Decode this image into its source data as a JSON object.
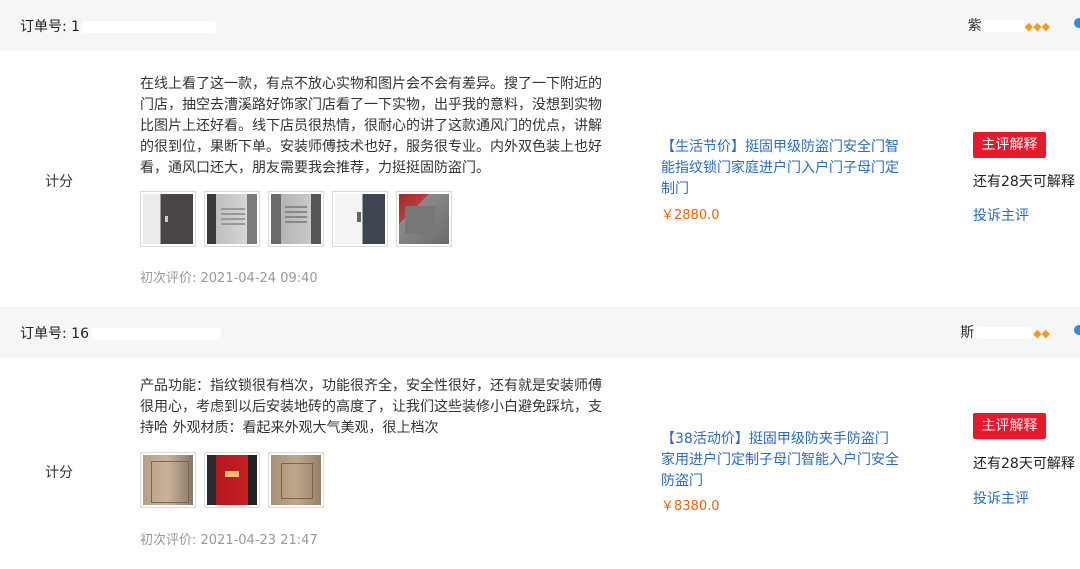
{
  "orders": [
    {
      "order_no_label": "订单号: 1",
      "buyer_name": "紫",
      "score_label": "计分",
      "review_text": "在线上看了这一款，有点不放心实物和图片会不会有差异。搜了一下附近的门店，抽空去漕溪路好饰家门店看了一下实物，出乎我的意料，没想到实物比图片上还好看。线下店员很热情，很耐心的讲了这款通风门的优点，讲解的很到位，果断下单。安装师傅技术也好，服务很专业。内外双色装上也好看，通风口还大，朋友需要我会推荐，力挺挺固防盗门。",
      "review_date": "初次评价: 2021-04-24 09:40",
      "product_title": "【生活节价】挺固甲级防盗门安全门智能指纹锁门家庭进户门入户门子母门定制门",
      "product_price": "￥2880.0",
      "reply_button": "主评解释",
      "remaining_text": "还有28天可解释",
      "complain_link": "投诉主评",
      "photos": [
        "door-photo-1",
        "door-photo-2",
        "door-photo-3",
        "door-photo-4",
        "door-photo-5"
      ]
    },
    {
      "order_no_label": "订单号: 16",
      "buyer_name": "斯",
      "score_label": "计分",
      "review_text": "产品功能：指纹锁很有档次，功能很齐全，安全性很好，还有就是安装师傅很用心，考虑到以后安装地砖的高度了，让我们这些装修小白避免踩坑，支持哈 外观材质：看起来外观大气美观，很上档次",
      "review_date": "初次评价: 2021-04-23 21:47",
      "product_title": "【38活动价】挺固甲级防夹手防盗门家用进户门定制子母门智能入户门安全防盗门",
      "product_price": "￥8380.0",
      "reply_button": "主评解释",
      "remaining_text": "还有28天可解释",
      "complain_link": "投诉主评",
      "photos": [
        "door-photo-1",
        "door-photo-2",
        "door-photo-3"
      ]
    }
  ],
  "colors": {
    "header_bg": "#f5f6f8",
    "link_blue": "#2a6bc4",
    "price_orange": "#f0620a",
    "button_red": "#e8192c",
    "gem_orange": "#f29b1c"
  }
}
